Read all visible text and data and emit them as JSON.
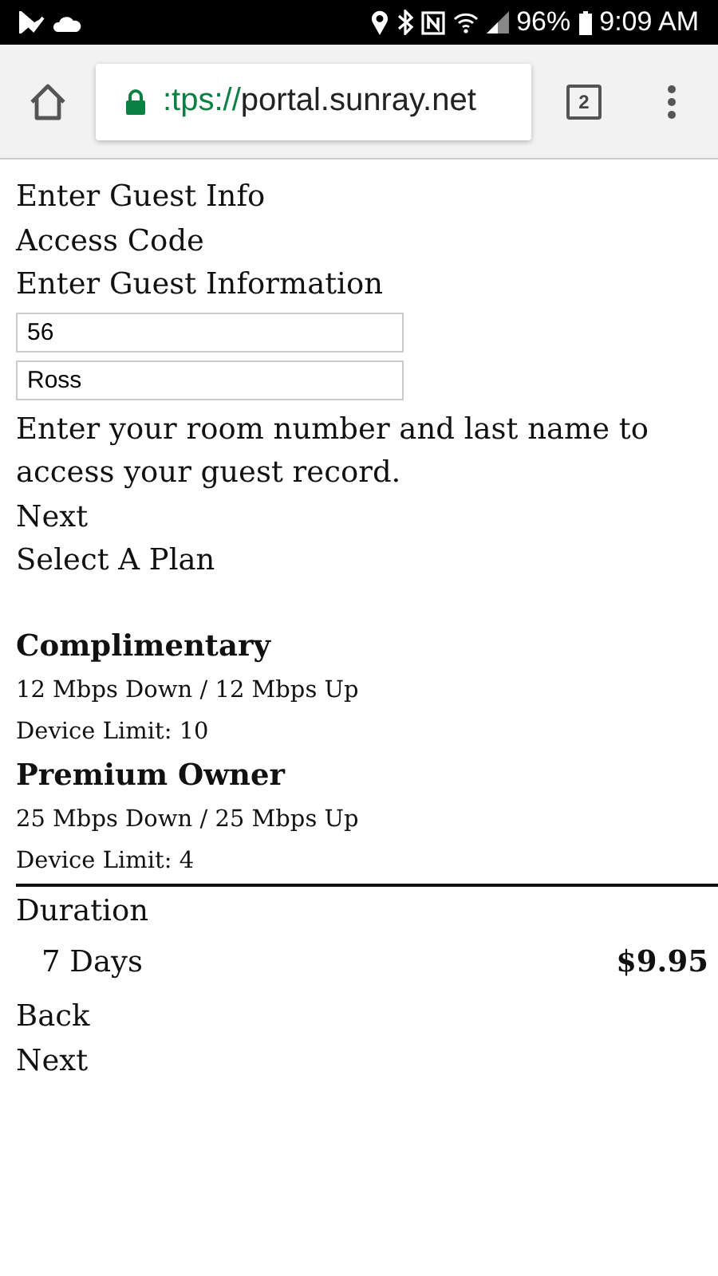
{
  "status_bar": {
    "battery": "96%",
    "time": "9:09 AM"
  },
  "browser": {
    "url_scheme": ":tps://",
    "url_host": "portal.sunray.net",
    "tab_count": "2"
  },
  "page": {
    "heading": "Enter Guest Info",
    "section": "Access Code",
    "subheading": "Enter Guest Information",
    "fields": [
      {
        "value": "56"
      },
      {
        "value": "Ross"
      }
    ],
    "instructions": "Enter your room number and last name to access your guest record.",
    "next_link": "Next",
    "plan_heading": "Select A Plan",
    "plans": [
      {
        "name": "Complimentary",
        "speed": "12 Mbps Down / 12 Mbps Up",
        "limit": "Device Limit: 10"
      },
      {
        "name": "Premium Owner",
        "speed": "25 Mbps Down / 25 Mbps Up",
        "limit": "Device Limit: 4"
      }
    ],
    "duration_label": "Duration",
    "durations": [
      {
        "label": "7 Days",
        "price": "$9.95"
      }
    ],
    "back_link": "Back",
    "next_link_2": "Next"
  }
}
